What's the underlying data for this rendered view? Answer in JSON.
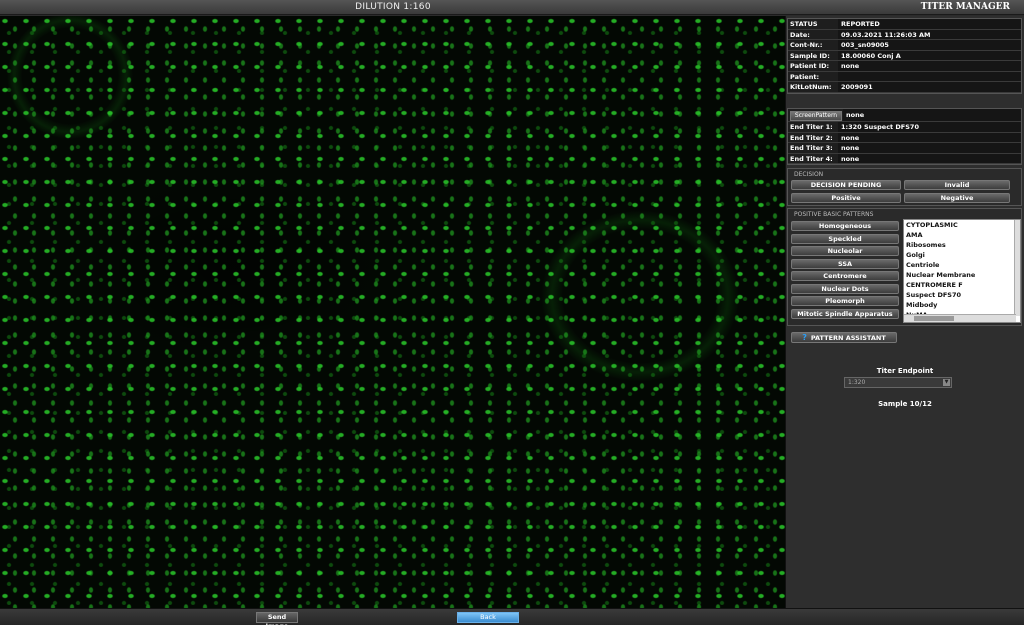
{
  "header": {
    "dilution_title": "DILUTION 1:160",
    "app_title": "TITER MANAGER"
  },
  "info": [
    {
      "label": "STATUS",
      "value": "REPORTED"
    },
    {
      "label": "Date:",
      "value": "09.03.2021 11:26:03 AM"
    },
    {
      "label": "Cont-Nr.:",
      "value": "003_sn09005"
    },
    {
      "label": "Sample ID:",
      "value": "18.00060 Conj A"
    },
    {
      "label": "Patient ID:",
      "value": "none"
    },
    {
      "label": "Patient:",
      "value": ""
    },
    {
      "label": "KitLotNum:",
      "value": "2009091"
    }
  ],
  "titers": {
    "screen_pattern_label": "ScreenPattern",
    "screen_pattern_value": "none",
    "rows": [
      {
        "label": "End Titer 1:",
        "value": "1:320 Suspect DFS70"
      },
      {
        "label": "End Titer 2:",
        "value": "none"
      },
      {
        "label": "End Titer 3:",
        "value": "none"
      },
      {
        "label": "End Titer 4:",
        "value": "none"
      }
    ]
  },
  "decision": {
    "title": "DECISION",
    "pending": "DECISION PENDING",
    "invalid": "Invalid",
    "positive": "Positive",
    "negative": "Negative"
  },
  "patterns": {
    "title": "POSITIVE BASIC PATTERNS",
    "buttons": [
      "Homogeneous",
      "Speckled",
      "Nucleolar",
      "SSA",
      "Centromere",
      "Nuclear Dots",
      "Pleomorph",
      "Mitotic Spindle Apparatus"
    ],
    "list": [
      "CYTOPLASMIC",
      "AMA",
      "Ribosomes",
      "Golgi",
      "Centriole",
      "Nuclear Membrane",
      "CENTROMERE F",
      "Suspect DFS70",
      "Midbody",
      "NuMA"
    ]
  },
  "assistant": {
    "label": "PATTERN ASSISTANT",
    "icon": "question-icon",
    "icon_glyph": "?",
    "icon_color": "#2a9df4"
  },
  "titer_endpoint": {
    "label": "Titer Endpoint",
    "value": "1:320",
    "arrow_glyph": "▼"
  },
  "sample": "Sample 10/12",
  "footer": {
    "send_image": "Send Image",
    "back": "Back"
  },
  "colors": {
    "accent_blue": "#3a8cd0",
    "fluorescence_green": "#28be28"
  }
}
